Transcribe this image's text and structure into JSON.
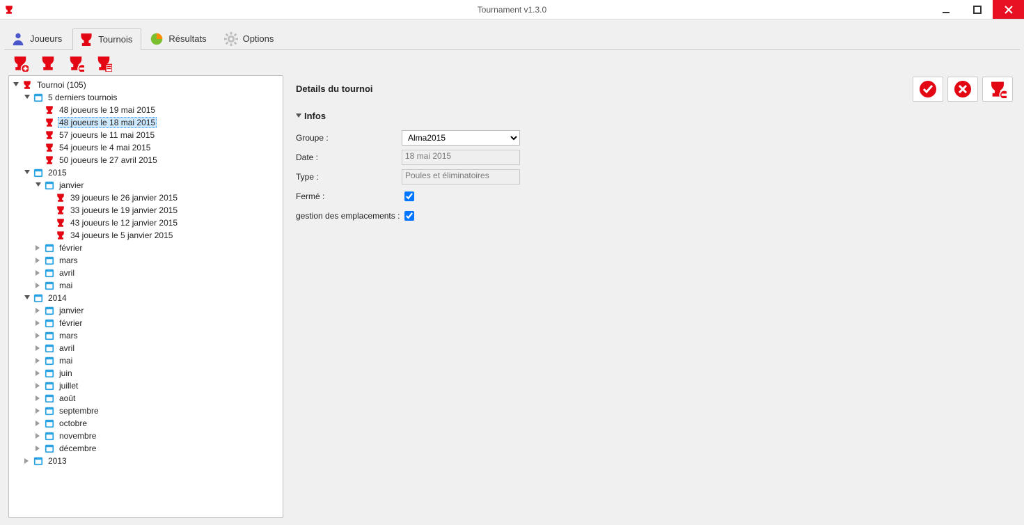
{
  "window": {
    "title": "Tournament v1.3.0"
  },
  "tabs": {
    "players": "Joueurs",
    "tournaments": "Tournois",
    "results": "Résultats",
    "options": "Options"
  },
  "tree": {
    "root": "Tournoi (105)",
    "recent_header": "5 derniers tournois",
    "recent": [
      "48 joueurs le 19 mai 2015",
      "48 joueurs le 18 mai 2015",
      "57 joueurs le 11 mai 2015",
      "54 joueurs le 4 mai 2015",
      "50 joueurs le 27 avril 2015"
    ],
    "y2015": {
      "label": "2015",
      "jan": {
        "label": "janvier",
        "items": [
          "39 joueurs le 26 janvier 2015",
          "33 joueurs le 19 janvier 2015",
          "43 joueurs le 12 janvier 2015",
          "34 joueurs le 5 janvier 2015"
        ]
      },
      "other_months": [
        "février",
        "mars",
        "avril",
        "mai"
      ]
    },
    "y2014": {
      "label": "2014",
      "months": [
        "janvier",
        "février",
        "mars",
        "avril",
        "mai",
        "juin",
        "juillet",
        "août",
        "septembre",
        "octobre",
        "novembre",
        "décembre"
      ]
    },
    "y2013": "2013"
  },
  "detail": {
    "header": "Details du tournoi",
    "section_infos": "Infos",
    "labels": {
      "group": "Groupe :",
      "date": "Date :",
      "type": "Type :",
      "closed": "Fermé :",
      "slots": "gestion des emplacements :"
    },
    "values": {
      "group": "Alma2015",
      "date": "18 mai 2015",
      "type": "Poules et éliminatoires",
      "closed": true,
      "slots": true
    },
    "group_options": [
      "Alma2015"
    ]
  }
}
